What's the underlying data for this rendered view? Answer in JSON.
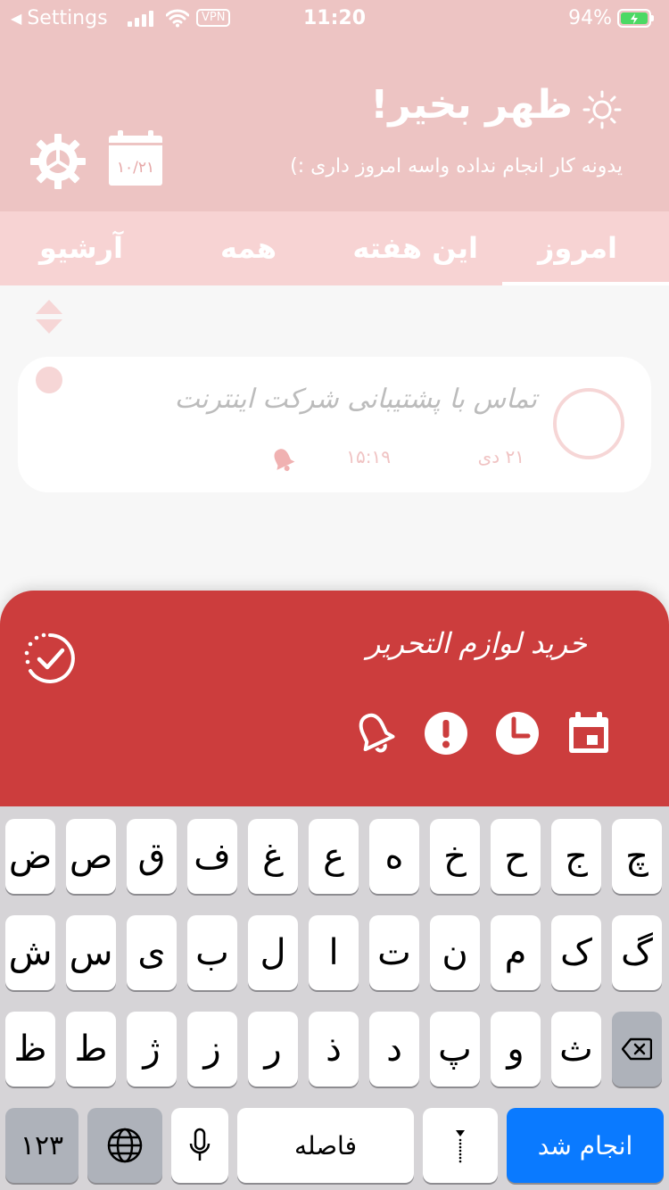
{
  "status_bar": {
    "back_label": "Settings",
    "vpn": "VPN",
    "time": "11:20",
    "battery_pct": "94%"
  },
  "header": {
    "greeting": "ظهر بخیر!",
    "subtitle": "یدونه کار انجام نداده واسه امروز داری :)",
    "calendar_date": "۱۰/۲۱"
  },
  "tabs": [
    {
      "label": "امروز",
      "active": true
    },
    {
      "label": "این هفته",
      "active": false
    },
    {
      "label": "همه",
      "active": false
    },
    {
      "label": "آرشیو",
      "active": false
    }
  ],
  "task": {
    "title": "تماس با پشتیبانی شرکت اینترنت",
    "date": "۲۱ دی",
    "time": "۱۵:۱۹"
  },
  "new_task": {
    "value": "خرید لوازم التحریر"
  },
  "keyboard": {
    "row1": [
      "ض",
      "ص",
      "ق",
      "ف",
      "غ",
      "ع",
      "ه",
      "خ",
      "ح",
      "ج",
      "چ"
    ],
    "row2": [
      "ش",
      "س",
      "ی",
      "ب",
      "ل",
      "ا",
      "ت",
      "ن",
      "م",
      "ک",
      "گ"
    ],
    "row3": [
      "ظ",
      "ط",
      "ژ",
      "ز",
      "ر",
      "ذ",
      "د",
      "پ",
      "و",
      "ث"
    ],
    "numbers_label": "۱۲۳",
    "space_label": "فاصله",
    "punct_label": "؛",
    "done_label": "انجام شد"
  },
  "colors": {
    "header": "#edc4c3",
    "tabs": "#f7d3d3",
    "sheet": "#cc3d3d",
    "done_key": "#0a7aff"
  }
}
